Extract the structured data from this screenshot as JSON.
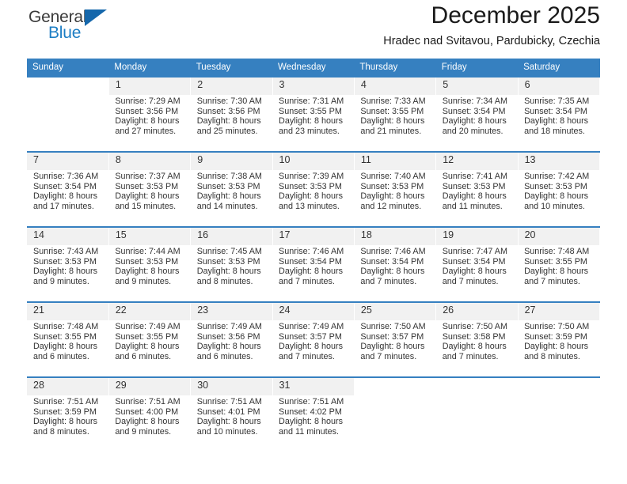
{
  "brand": {
    "name_top": "General",
    "name_bottom": "Blue",
    "accent_color": "#1567ab",
    "text_color": "#3b3b3b",
    "triangle_icon": "triangle-icon"
  },
  "header": {
    "title": "December 2025",
    "subtitle": "Hradec nad Svitavou, Pardubicky, Czechia"
  },
  "theme": {
    "header_bg": "#3680c0",
    "daynum_bg": "#f1f1f1",
    "cell_bg": "#ffffff",
    "text": "#333333"
  },
  "weekday_headers": [
    "Sunday",
    "Monday",
    "Tuesday",
    "Wednesday",
    "Thursday",
    "Friday",
    "Saturday"
  ],
  "labels": {
    "sunrise_prefix": "Sunrise:",
    "sunset_prefix": "Sunset:",
    "daylight_prefix": "Daylight:"
  },
  "weeks": [
    {
      "days": [
        {
          "num": "",
          "l1": "",
          "l2": "",
          "l3": "",
          "l4": ""
        },
        {
          "num": "1",
          "l1": "Sunrise: 7:29 AM",
          "l2": "Sunset: 3:56 PM",
          "l3": "Daylight: 8 hours",
          "l4": "and 27 minutes."
        },
        {
          "num": "2",
          "l1": "Sunrise: 7:30 AM",
          "l2": "Sunset: 3:56 PM",
          "l3": "Daylight: 8 hours",
          "l4": "and 25 minutes."
        },
        {
          "num": "3",
          "l1": "Sunrise: 7:31 AM",
          "l2": "Sunset: 3:55 PM",
          "l3": "Daylight: 8 hours",
          "l4": "and 23 minutes."
        },
        {
          "num": "4",
          "l1": "Sunrise: 7:33 AM",
          "l2": "Sunset: 3:55 PM",
          "l3": "Daylight: 8 hours",
          "l4": "and 21 minutes."
        },
        {
          "num": "5",
          "l1": "Sunrise: 7:34 AM",
          "l2": "Sunset: 3:54 PM",
          "l3": "Daylight: 8 hours",
          "l4": "and 20 minutes."
        },
        {
          "num": "6",
          "l1": "Sunrise: 7:35 AM",
          "l2": "Sunset: 3:54 PM",
          "l3": "Daylight: 8 hours",
          "l4": "and 18 minutes."
        }
      ]
    },
    {
      "days": [
        {
          "num": "7",
          "l1": "Sunrise: 7:36 AM",
          "l2": "Sunset: 3:54 PM",
          "l3": "Daylight: 8 hours",
          "l4": "and 17 minutes."
        },
        {
          "num": "8",
          "l1": "Sunrise: 7:37 AM",
          "l2": "Sunset: 3:53 PM",
          "l3": "Daylight: 8 hours",
          "l4": "and 15 minutes."
        },
        {
          "num": "9",
          "l1": "Sunrise: 7:38 AM",
          "l2": "Sunset: 3:53 PM",
          "l3": "Daylight: 8 hours",
          "l4": "and 14 minutes."
        },
        {
          "num": "10",
          "l1": "Sunrise: 7:39 AM",
          "l2": "Sunset: 3:53 PM",
          "l3": "Daylight: 8 hours",
          "l4": "and 13 minutes."
        },
        {
          "num": "11",
          "l1": "Sunrise: 7:40 AM",
          "l2": "Sunset: 3:53 PM",
          "l3": "Daylight: 8 hours",
          "l4": "and 12 minutes."
        },
        {
          "num": "12",
          "l1": "Sunrise: 7:41 AM",
          "l2": "Sunset: 3:53 PM",
          "l3": "Daylight: 8 hours",
          "l4": "and 11 minutes."
        },
        {
          "num": "13",
          "l1": "Sunrise: 7:42 AM",
          "l2": "Sunset: 3:53 PM",
          "l3": "Daylight: 8 hours",
          "l4": "and 10 minutes."
        }
      ]
    },
    {
      "days": [
        {
          "num": "14",
          "l1": "Sunrise: 7:43 AM",
          "l2": "Sunset: 3:53 PM",
          "l3": "Daylight: 8 hours",
          "l4": "and 9 minutes."
        },
        {
          "num": "15",
          "l1": "Sunrise: 7:44 AM",
          "l2": "Sunset: 3:53 PM",
          "l3": "Daylight: 8 hours",
          "l4": "and 9 minutes."
        },
        {
          "num": "16",
          "l1": "Sunrise: 7:45 AM",
          "l2": "Sunset: 3:53 PM",
          "l3": "Daylight: 8 hours",
          "l4": "and 8 minutes."
        },
        {
          "num": "17",
          "l1": "Sunrise: 7:46 AM",
          "l2": "Sunset: 3:54 PM",
          "l3": "Daylight: 8 hours",
          "l4": "and 7 minutes."
        },
        {
          "num": "18",
          "l1": "Sunrise: 7:46 AM",
          "l2": "Sunset: 3:54 PM",
          "l3": "Daylight: 8 hours",
          "l4": "and 7 minutes."
        },
        {
          "num": "19",
          "l1": "Sunrise: 7:47 AM",
          "l2": "Sunset: 3:54 PM",
          "l3": "Daylight: 8 hours",
          "l4": "and 7 minutes."
        },
        {
          "num": "20",
          "l1": "Sunrise: 7:48 AM",
          "l2": "Sunset: 3:55 PM",
          "l3": "Daylight: 8 hours",
          "l4": "and 7 minutes."
        }
      ]
    },
    {
      "days": [
        {
          "num": "21",
          "l1": "Sunrise: 7:48 AM",
          "l2": "Sunset: 3:55 PM",
          "l3": "Daylight: 8 hours",
          "l4": "and 6 minutes."
        },
        {
          "num": "22",
          "l1": "Sunrise: 7:49 AM",
          "l2": "Sunset: 3:55 PM",
          "l3": "Daylight: 8 hours",
          "l4": "and 6 minutes."
        },
        {
          "num": "23",
          "l1": "Sunrise: 7:49 AM",
          "l2": "Sunset: 3:56 PM",
          "l3": "Daylight: 8 hours",
          "l4": "and 6 minutes."
        },
        {
          "num": "24",
          "l1": "Sunrise: 7:49 AM",
          "l2": "Sunset: 3:57 PM",
          "l3": "Daylight: 8 hours",
          "l4": "and 7 minutes."
        },
        {
          "num": "25",
          "l1": "Sunrise: 7:50 AM",
          "l2": "Sunset: 3:57 PM",
          "l3": "Daylight: 8 hours",
          "l4": "and 7 minutes."
        },
        {
          "num": "26",
          "l1": "Sunrise: 7:50 AM",
          "l2": "Sunset: 3:58 PM",
          "l3": "Daylight: 8 hours",
          "l4": "and 7 minutes."
        },
        {
          "num": "27",
          "l1": "Sunrise: 7:50 AM",
          "l2": "Sunset: 3:59 PM",
          "l3": "Daylight: 8 hours",
          "l4": "and 8 minutes."
        }
      ]
    },
    {
      "days": [
        {
          "num": "28",
          "l1": "Sunrise: 7:51 AM",
          "l2": "Sunset: 3:59 PM",
          "l3": "Daylight: 8 hours",
          "l4": "and 8 minutes."
        },
        {
          "num": "29",
          "l1": "Sunrise: 7:51 AM",
          "l2": "Sunset: 4:00 PM",
          "l3": "Daylight: 8 hours",
          "l4": "and 9 minutes."
        },
        {
          "num": "30",
          "l1": "Sunrise: 7:51 AM",
          "l2": "Sunset: 4:01 PM",
          "l3": "Daylight: 8 hours",
          "l4": "and 10 minutes."
        },
        {
          "num": "31",
          "l1": "Sunrise: 7:51 AM",
          "l2": "Sunset: 4:02 PM",
          "l3": "Daylight: 8 hours",
          "l4": "and 11 minutes."
        },
        {
          "num": "",
          "l1": "",
          "l2": "",
          "l3": "",
          "l4": ""
        },
        {
          "num": "",
          "l1": "",
          "l2": "",
          "l3": "",
          "l4": ""
        },
        {
          "num": "",
          "l1": "",
          "l2": "",
          "l3": "",
          "l4": ""
        }
      ]
    }
  ]
}
